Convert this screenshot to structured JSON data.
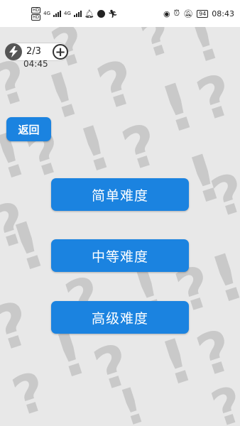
{
  "status_bar": {
    "left_badges": [
      "HD",
      "HD"
    ],
    "network_labels": [
      "4G",
      "4G"
    ],
    "battery": "94",
    "time": "08:43"
  },
  "energy": {
    "count": "2/3",
    "add_symbol": "+",
    "icon": "lightning-icon"
  },
  "timer": "04:45",
  "back_label": "返回",
  "levels": [
    {
      "label": "简单难度"
    },
    {
      "label": "中等难度"
    },
    {
      "label": "高级难度"
    }
  ],
  "background": {
    "glyphs": [
      "?",
      "!"
    ]
  },
  "colors": {
    "accent": "#1b83e0",
    "background": "#e8e8e8",
    "pattern": "#c9c9c9"
  }
}
